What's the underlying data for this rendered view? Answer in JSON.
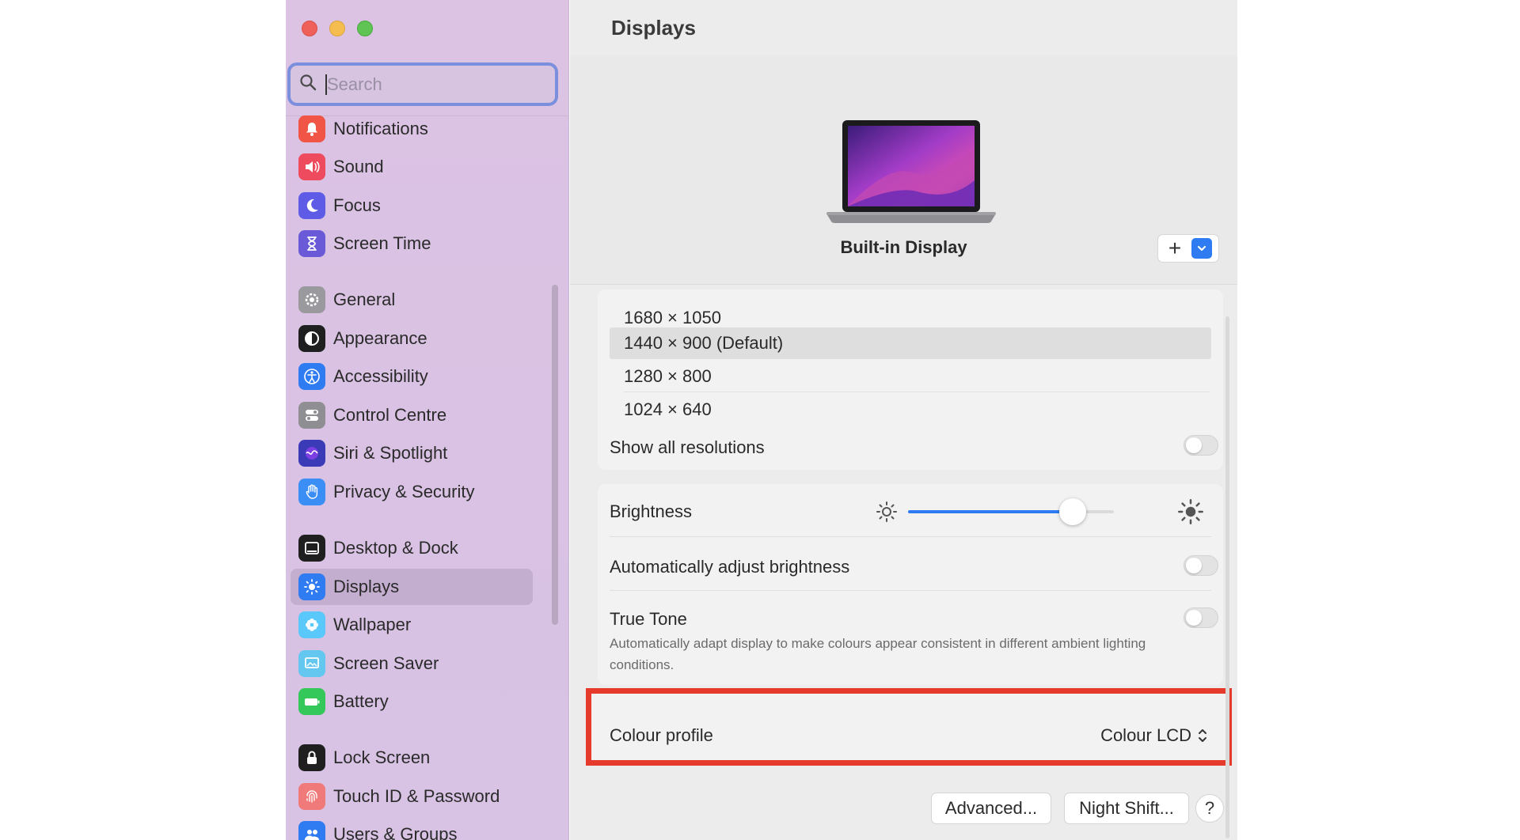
{
  "sidebar": {
    "search_placeholder": "Search",
    "items": [
      {
        "label": "Notifications",
        "icon": "bell-icon",
        "color": "#f05545"
      },
      {
        "label": "Sound",
        "icon": "speaker-icon",
        "color": "#ee4b5e"
      },
      {
        "label": "Focus",
        "icon": "moon-icon",
        "color": "#5e5ce6"
      },
      {
        "label": "Screen Time",
        "icon": "hourglass-icon",
        "color": "#6a5ad8"
      },
      {
        "label": "General",
        "icon": "gear-icon",
        "color": "#9a9a9e"
      },
      {
        "label": "Appearance",
        "icon": "appearance-icon",
        "color": "#1f1f1f"
      },
      {
        "label": "Accessibility",
        "icon": "accessibility-icon",
        "color": "#2f7bf2"
      },
      {
        "label": "Control Centre",
        "icon": "control-centre-icon",
        "color": "#8e8e93"
      },
      {
        "label": "Siri & Spotlight",
        "icon": "siri-icon",
        "color": "#3b3bb8"
      },
      {
        "label": "Privacy & Security",
        "icon": "hand-icon",
        "color": "#3a8ef5"
      },
      {
        "label": "Desktop & Dock",
        "icon": "dock-icon",
        "color": "#1f1f1f"
      },
      {
        "label": "Displays",
        "icon": "sun-icon",
        "color": "#2f7bf2",
        "selected": true
      },
      {
        "label": "Wallpaper",
        "icon": "flower-icon",
        "color": "#5ac8fa"
      },
      {
        "label": "Screen Saver",
        "icon": "screensaver-icon",
        "color": "#64c7f0"
      },
      {
        "label": "Battery",
        "icon": "battery-icon",
        "color": "#34c759"
      },
      {
        "label": "Lock Screen",
        "icon": "lock-icon",
        "color": "#1f1f1f"
      },
      {
        "label": "Touch ID & Password",
        "icon": "fingerprint-icon",
        "color": "#f07a7a"
      },
      {
        "label": "Users & Groups",
        "icon": "users-icon",
        "color": "#2f7bf2"
      }
    ]
  },
  "main": {
    "title": "Displays",
    "display_name": "Built-in Display",
    "resolutions": [
      {
        "label": "1680 × 1050",
        "selected": false
      },
      {
        "label": "1440 × 900 (Default)",
        "selected": true
      },
      {
        "label": "1280 × 800",
        "selected": false
      },
      {
        "label": "1024 × 640",
        "selected": false
      }
    ],
    "show_all_resolutions": {
      "label": "Show all resolutions",
      "on": false
    },
    "brightness": {
      "label": "Brightness",
      "value": 0.8
    },
    "auto_brightness": {
      "label": "Automatically adjust brightness",
      "on": false
    },
    "true_tone": {
      "label": "True Tone",
      "description": "Automatically adapt display to make colours appear consistent in different ambient lighting conditions.",
      "on": false
    },
    "colour_profile": {
      "label": "Colour profile",
      "value": "Colour LCD"
    },
    "buttons": {
      "advanced": "Advanced...",
      "night_shift": "Night Shift...",
      "help": "?"
    },
    "accent_color": "#2f7bf2",
    "highlight_color": "#e63a2c"
  }
}
